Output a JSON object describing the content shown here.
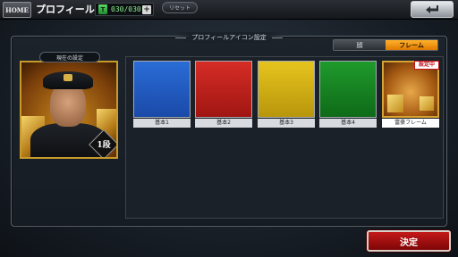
{
  "header": {
    "home_label": "HOME",
    "screen_title": "プロフィール",
    "ticket_count": "030/030",
    "ticket_plus": "+",
    "reset_label": "リセット",
    "back_icon": "return-arrow-icon"
  },
  "panel": {
    "title": "プロフィールアイコン設定",
    "current_label": "現在の設定",
    "current_rank": "1段"
  },
  "tabs": [
    {
      "label": "顔",
      "active": false
    },
    {
      "label": "フレーム",
      "active": true
    }
  ],
  "frames": [
    {
      "name": "基本1",
      "color": "#2a6cd6"
    },
    {
      "name": "基本2",
      "color": "#d62c26"
    },
    {
      "name": "基本3",
      "color": "#e6c41e"
    },
    {
      "name": "基本4",
      "color": "#1f9a2c"
    },
    {
      "name": "富豪フレーム",
      "color": "#c8891d",
      "in_use": true,
      "badge": "設定中"
    }
  ],
  "footer": {
    "confirm_label": "決定"
  }
}
